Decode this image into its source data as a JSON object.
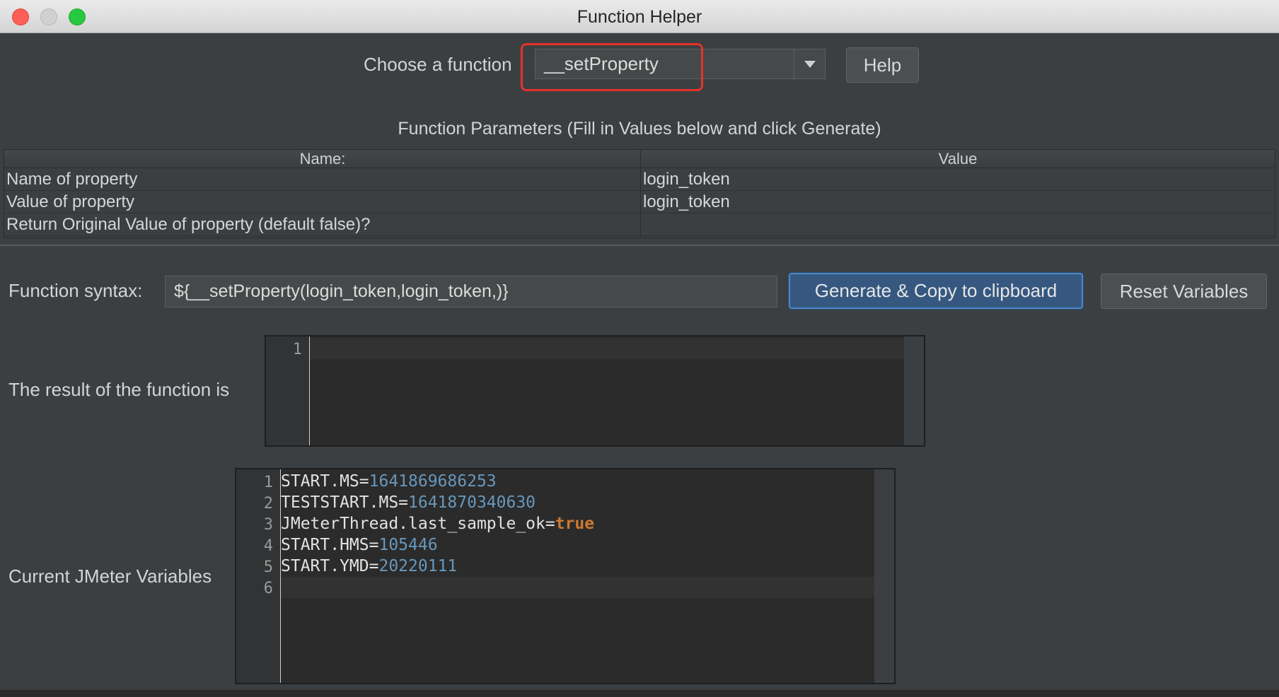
{
  "window": {
    "title": "Function Helper"
  },
  "chooser": {
    "label": "Choose a function",
    "selected": "__setProperty",
    "help_label": "Help"
  },
  "parameters": {
    "heading": "Function Parameters (Fill in Values below and click Generate)",
    "columns": [
      "Name:",
      "Value"
    ],
    "rows": [
      {
        "name": "Name of property",
        "value": "login_token"
      },
      {
        "name": "Value of property",
        "value": "login_token"
      },
      {
        "name": "Return Original Value of property (default false)?",
        "value": ""
      }
    ]
  },
  "syntax": {
    "label": "Function syntax:",
    "value": "${__setProperty(login_token,login_token,)}",
    "generate_label": "Generate & Copy to clipboard",
    "reset_label": "Reset Variables"
  },
  "result": {
    "label": "The result of the function is",
    "line_numbers": [
      "1"
    ]
  },
  "variables": {
    "label": "Current JMeter Variables",
    "line_numbers": [
      "1",
      "2",
      "3",
      "4",
      "5",
      "6"
    ],
    "lines": [
      {
        "key": "START.MS=",
        "value": "1641869686253",
        "type": "num"
      },
      {
        "key": "TESTSTART.MS=",
        "value": "1641870340630",
        "type": "num"
      },
      {
        "key": "JMeterThread.last_sample_ok=",
        "value": "true",
        "type": "kw"
      },
      {
        "key": "START.HMS=",
        "value": "105446",
        "type": "num"
      },
      {
        "key": "START.YMD=",
        "value": "20220111",
        "type": "num"
      }
    ]
  }
}
